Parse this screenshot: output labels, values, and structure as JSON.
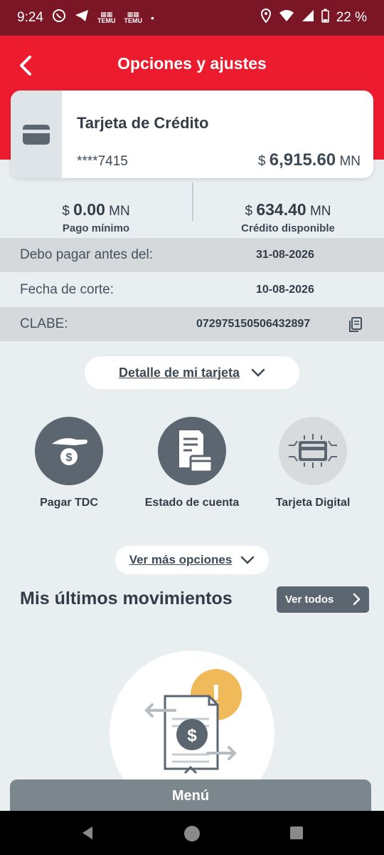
{
  "status_bar": {
    "time": "9:24",
    "temu_label": "TEMU",
    "battery": "22 %"
  },
  "header": {
    "title": "Opciones y ajustes"
  },
  "card": {
    "title": "Tarjeta de Crédito",
    "number": "****7415",
    "currency_symbol": "$",
    "balance": "6,915.60",
    "currency_code": "MN"
  },
  "summary": {
    "min_payment": {
      "symbol": "$",
      "amount": "0.00",
      "code": "MN",
      "label": "Pago mínimo"
    },
    "available": {
      "symbol": "$",
      "amount": "634.40",
      "code": "MN",
      "label": "Crédito disponible"
    }
  },
  "info": {
    "due": {
      "label": "Debo pagar antes del:",
      "value": "31-08-2026"
    },
    "cut": {
      "label": "Fecha de corte:",
      "value": "10-08-2026"
    },
    "clabe": {
      "label": "CLABE:",
      "value": "072975150506432897"
    }
  },
  "detail_toggle": "Detalle de mi tarjeta",
  "actions": [
    {
      "label": "Pagar TDC",
      "icon": "hand-coin-icon"
    },
    {
      "label": "Estado de cuenta",
      "icon": "statement-icon"
    },
    {
      "label": "Tarjeta Digital",
      "icon": "digital-card-icon"
    }
  ],
  "more_options": "Ver más opciones",
  "movements": {
    "title": "Mis últimos movimientos",
    "see_all": "Ver todos"
  },
  "menu": "Menú",
  "colors": {
    "brand_red": "#ec1c2e",
    "status_bar": "#7a1626",
    "dark_gray": "#5b6670",
    "accent_yellow": "#f0b95a"
  }
}
